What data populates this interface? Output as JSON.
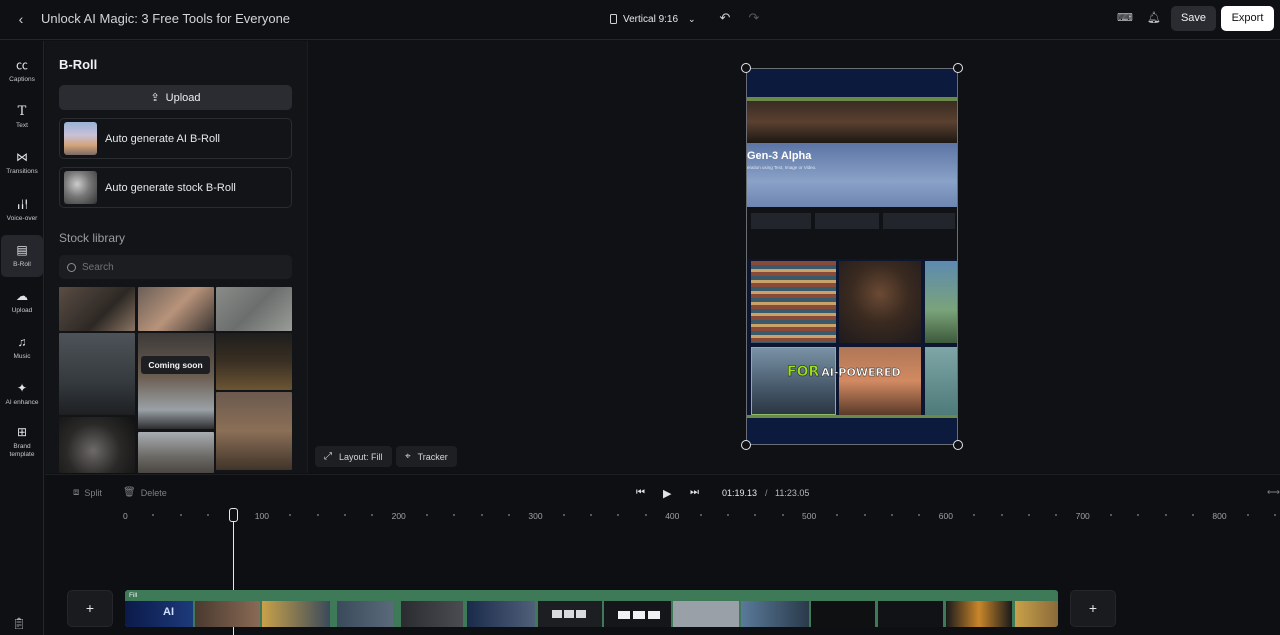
{
  "header": {
    "title": "Unlock AI Magic: 3 Free Tools for Everyone",
    "aspect_label": "Vertical 9:16",
    "save_label": "Save",
    "export_label": "Export"
  },
  "rail": {
    "items": [
      {
        "label": "Captions",
        "icon": "cc-icon",
        "glyph": "㏄"
      },
      {
        "label": "Text",
        "icon": "text-icon",
        "glyph": "T"
      },
      {
        "label": "Transitions",
        "icon": "transitions-icon",
        "glyph": "⋈"
      },
      {
        "label": "Voice-over",
        "icon": "waveform-icon",
        "glyph": "╻╽╿"
      },
      {
        "label": "B-Roll",
        "icon": "broll-icon",
        "glyph": "▤"
      },
      {
        "label": "Upload",
        "icon": "cloud-upload-icon",
        "glyph": "☁"
      },
      {
        "label": "Music",
        "icon": "music-icon",
        "glyph": "♫"
      },
      {
        "label": "AI enhance",
        "icon": "sparkle-icon",
        "glyph": "✦"
      },
      {
        "label": "Brand template",
        "icon": "grid-plus-icon",
        "glyph": "⊞"
      }
    ],
    "active": "B-Roll"
  },
  "panel": {
    "title": "B-Roll",
    "upload_label": "Upload",
    "auto_ai_label": "Auto generate AI B-Roll",
    "auto_stock_label": "Auto generate stock B-Roll",
    "stock_library_label": "Stock library",
    "search_placeholder": "Search",
    "coming_soon_label": "Coming soon"
  },
  "stage": {
    "layout_label": "Layout: Fill",
    "tracker_label": "Tracker",
    "canvas_text": {
      "heading": "Gen-3 Alpha",
      "subheading": "eration using Text, Image or Video.",
      "caption_for": "FOR",
      "caption_rest": "AI-POWERED"
    }
  },
  "timeline": {
    "split_label": "Split",
    "delete_label": "Delete",
    "current_time": "01:19.13",
    "separator": "/",
    "total_time": "11:23.05",
    "ruler_labels": [
      "0",
      "100",
      "200",
      "300",
      "400",
      "500",
      "600",
      "700",
      "800"
    ],
    "track_label": "Fill",
    "colors": {
      "track": "#3f7a58",
      "playhead": "#e6e7ea"
    }
  }
}
